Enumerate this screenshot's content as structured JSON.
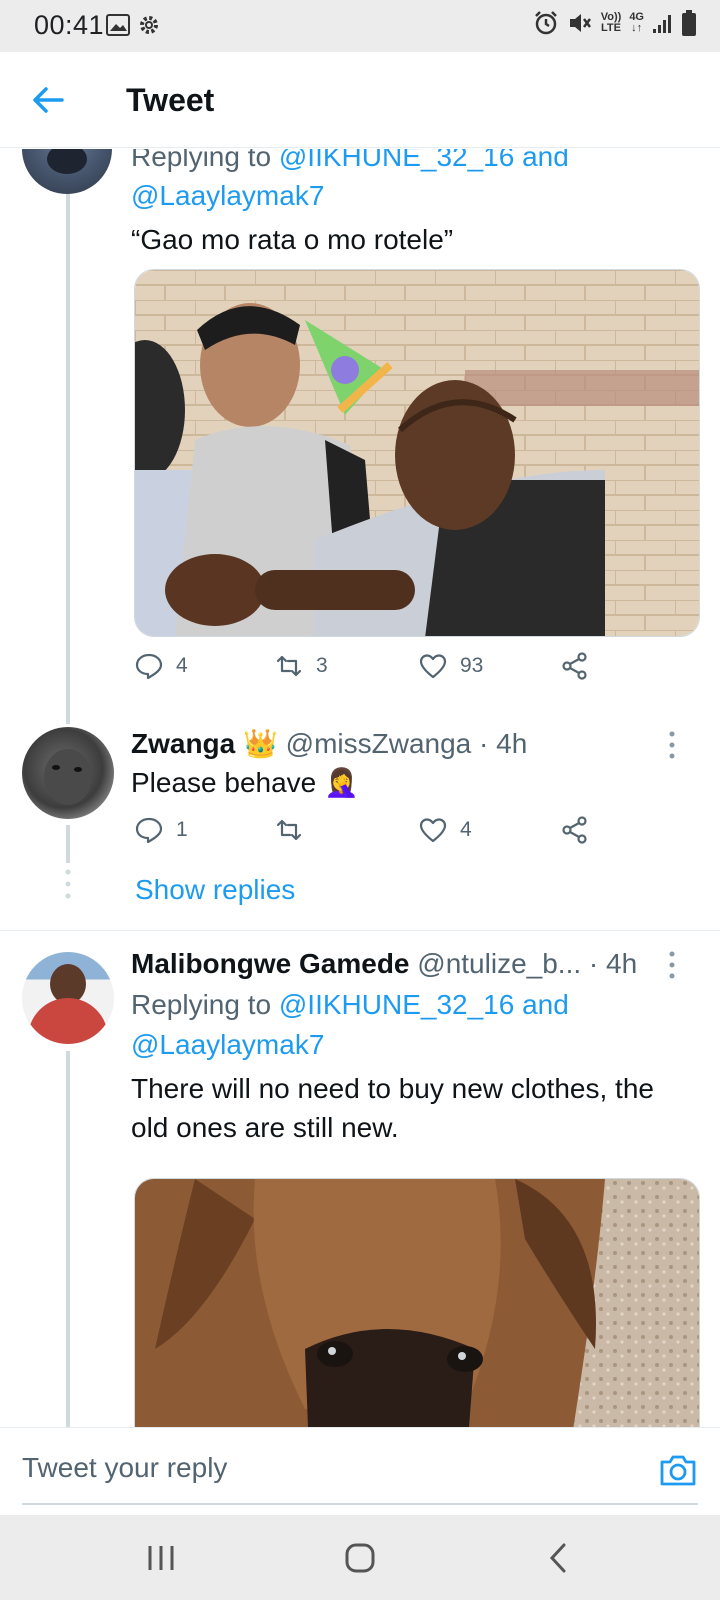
{
  "status_bar": {
    "time": "00:41",
    "icons": [
      "image-icon",
      "settings-gear-icon",
      "alarm-icon",
      "mute-icon",
      "volte-icon",
      "4g-icon",
      "signal-icon",
      "battery-icon"
    ],
    "volte_top": "Vo))",
    "volte_bottom": "LTE",
    "net_top": "4G",
    "net_bottom": "↓↑"
  },
  "header": {
    "title": "Tweet"
  },
  "tweets": [
    {
      "replying_prefix": "Replying to",
      "replying_user1": "@IIKHUNE_32_16",
      "replying_and": "and",
      "replying_user2": "@Laaylaymak7",
      "text": "“Gao mo rata o mo rotele”",
      "actions": {
        "replies": "4",
        "retweets": "3",
        "likes": "93"
      }
    },
    {
      "display_name": "Zwanga",
      "badge_emoji": "👑",
      "handle_time": "@missZwanga · 4h",
      "text": "Please behave 🤦‍♀️",
      "actions": {
        "replies": "1",
        "retweets": "",
        "likes": "4"
      },
      "show_replies": "Show replies"
    },
    {
      "display_name": "Malibongwe Gamede",
      "handle_time": "@ntulize_b... · 4h",
      "replying_prefix": "Replying to",
      "replying_user1": "@IIKHUNE_32_16",
      "replying_and": "and",
      "replying_user2": "@Laaylaymak7",
      "text_line1": "There will no need to buy new clothes, the",
      "text_line2": "old ones are still new."
    }
  ],
  "reply_bar": {
    "placeholder": "Tweet your reply"
  },
  "colors": {
    "accent": "#1d9bf0",
    "text": "#0f1419",
    "secondary": "#536471",
    "thread_line": "#cfd9de"
  }
}
